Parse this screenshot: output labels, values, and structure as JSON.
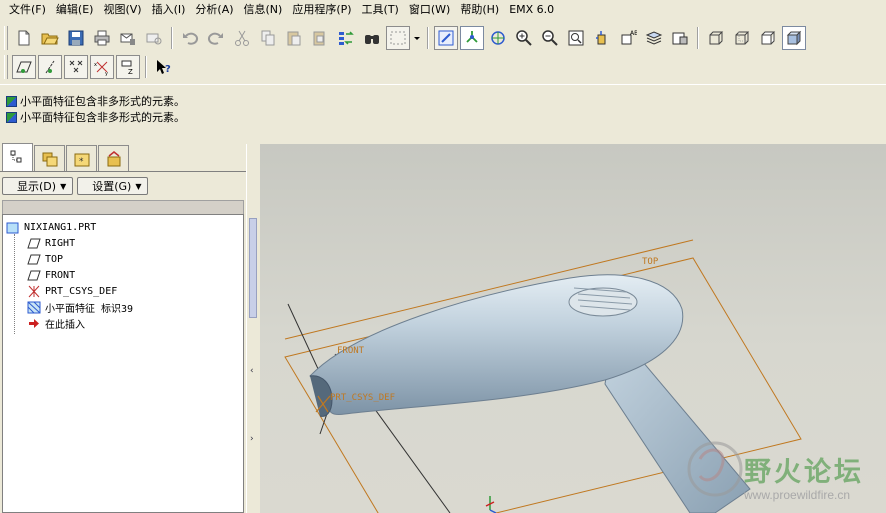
{
  "menu": [
    {
      "label": "文件(F)"
    },
    {
      "label": "编辑(E)"
    },
    {
      "label": "视图(V)"
    },
    {
      "label": "插入(I)"
    },
    {
      "label": "分析(A)"
    },
    {
      "label": "信息(N)"
    },
    {
      "label": "应用程序(P)"
    },
    {
      "label": "工具(T)"
    },
    {
      "label": "窗口(W)"
    },
    {
      "label": "帮助(H)"
    },
    {
      "label": "EMX 6.0"
    }
  ],
  "messages": [
    "小平面特征包含非多形式的元素。",
    "小平面特征包含非多形式的元素。"
  ],
  "tree_controls": {
    "show_label": "显示(D)",
    "settings_label": "设置(G)"
  },
  "model_tree": {
    "root": "NIXIANG1.PRT",
    "items": [
      "RIGHT",
      "TOP",
      "FRONT",
      "PRT_CSYS_DEF",
      "小平面特征 标识39",
      "在此插入"
    ]
  },
  "viewport": {
    "datum_labels": {
      "top": "TOP",
      "front": "FRONT",
      "csys": "PRT_CSYS_DEF"
    },
    "watermark": {
      "title": "野火论坛",
      "url": "www.proewildfire.cn"
    }
  },
  "colors": {
    "datum": "#c07820",
    "model_surface": "#b8c8d4",
    "watermark_green": "#80b07a",
    "arrow_red": "#cc2020"
  }
}
